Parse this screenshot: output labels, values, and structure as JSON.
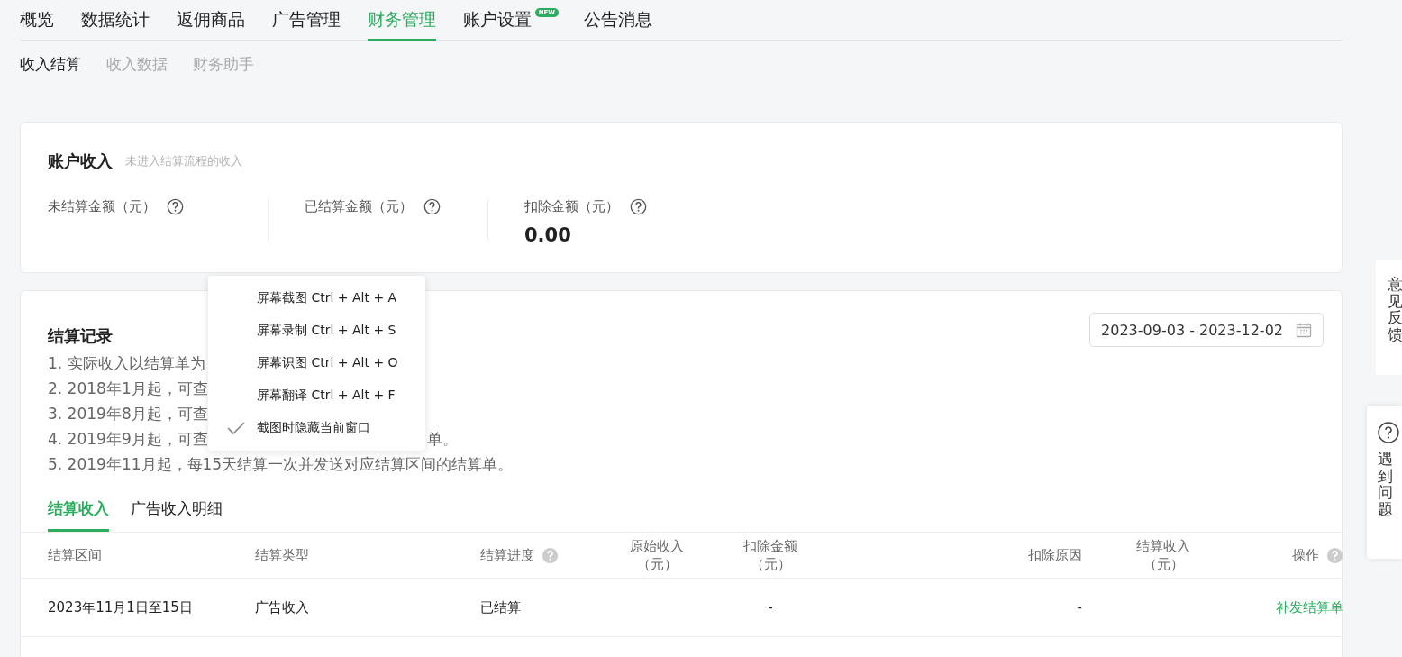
{
  "top_nav": [
    {
      "label": "概览",
      "selected": false
    },
    {
      "label": "数据统计",
      "selected": false
    },
    {
      "label": "返佣商品",
      "selected": false
    },
    {
      "label": "广告管理",
      "selected": false
    },
    {
      "label": "财务管理",
      "selected": true
    },
    {
      "label": "账户设置",
      "selected": false,
      "badge": "NEW"
    },
    {
      "label": "公告消息",
      "selected": false
    }
  ],
  "sub_nav": [
    {
      "label": "收入结算",
      "selected": true
    },
    {
      "label": "收入数据",
      "selected": false
    },
    {
      "label": "财务助手",
      "selected": false
    }
  ],
  "account_income": {
    "title": "账户收入",
    "hint": "未进入结算流程的收入",
    "stats": [
      {
        "label": "未结算金额（元）"
      },
      {
        "label": "已结算金额（元）"
      },
      {
        "label": "扣除金额（元）",
        "value": "0.00"
      }
    ]
  },
  "settlement_records": {
    "title": "结算记录",
    "date_range": "2023-09-03 - 2023-12-02",
    "notes": [
      {
        "start": "1. 实际收入以结算单为"
      },
      {
        "start": "2. 2018年1月起，可查"
      },
      {
        "start": "3. 2019年8月起，可查"
      },
      {
        "start": "4. 2019年9月起，可查",
        "end": "单。"
      },
      {
        "start": "5. 2019年11月起，每15天结算一次并发送对应结算区间的结算单。"
      }
    ],
    "tabs": [
      {
        "label": "结算收入",
        "selected": true
      },
      {
        "label": "广告收入明细",
        "selected": false
      }
    ],
    "table": {
      "columns": [
        {
          "label": "结算区间"
        },
        {
          "label": "结算类型"
        },
        {
          "label": "结算进度",
          "help": true
        },
        {
          "label": "原始收入",
          "unit": "（元）"
        },
        {
          "label": "扣除金额",
          "unit": "（元）"
        },
        {
          "label": "扣除原因"
        },
        {
          "label": "结算收入",
          "unit": "（元）"
        },
        {
          "label": "操作",
          "help": true
        }
      ],
      "rows": [
        {
          "cells": [
            "2023年11月1日至15日",
            "广告收入",
            "已结算",
            "",
            "-",
            "-",
            "",
            "补发结算单"
          ]
        }
      ]
    }
  },
  "context_menu": {
    "items": [
      {
        "label": "屏幕截图 Ctrl + Alt + A",
        "checked": false
      },
      {
        "label": "屏幕录制 Ctrl + Alt + S",
        "checked": false
      },
      {
        "label": "屏幕识图 Ctrl + Alt + O",
        "checked": false
      },
      {
        "label": "屏幕翻译 Ctrl + Alt + F",
        "checked": false
      },
      {
        "label": "截图时隐藏当前窗口",
        "checked": true
      }
    ]
  },
  "side_panels": {
    "feedback": "意见反馈",
    "help": "遇到问题"
  }
}
